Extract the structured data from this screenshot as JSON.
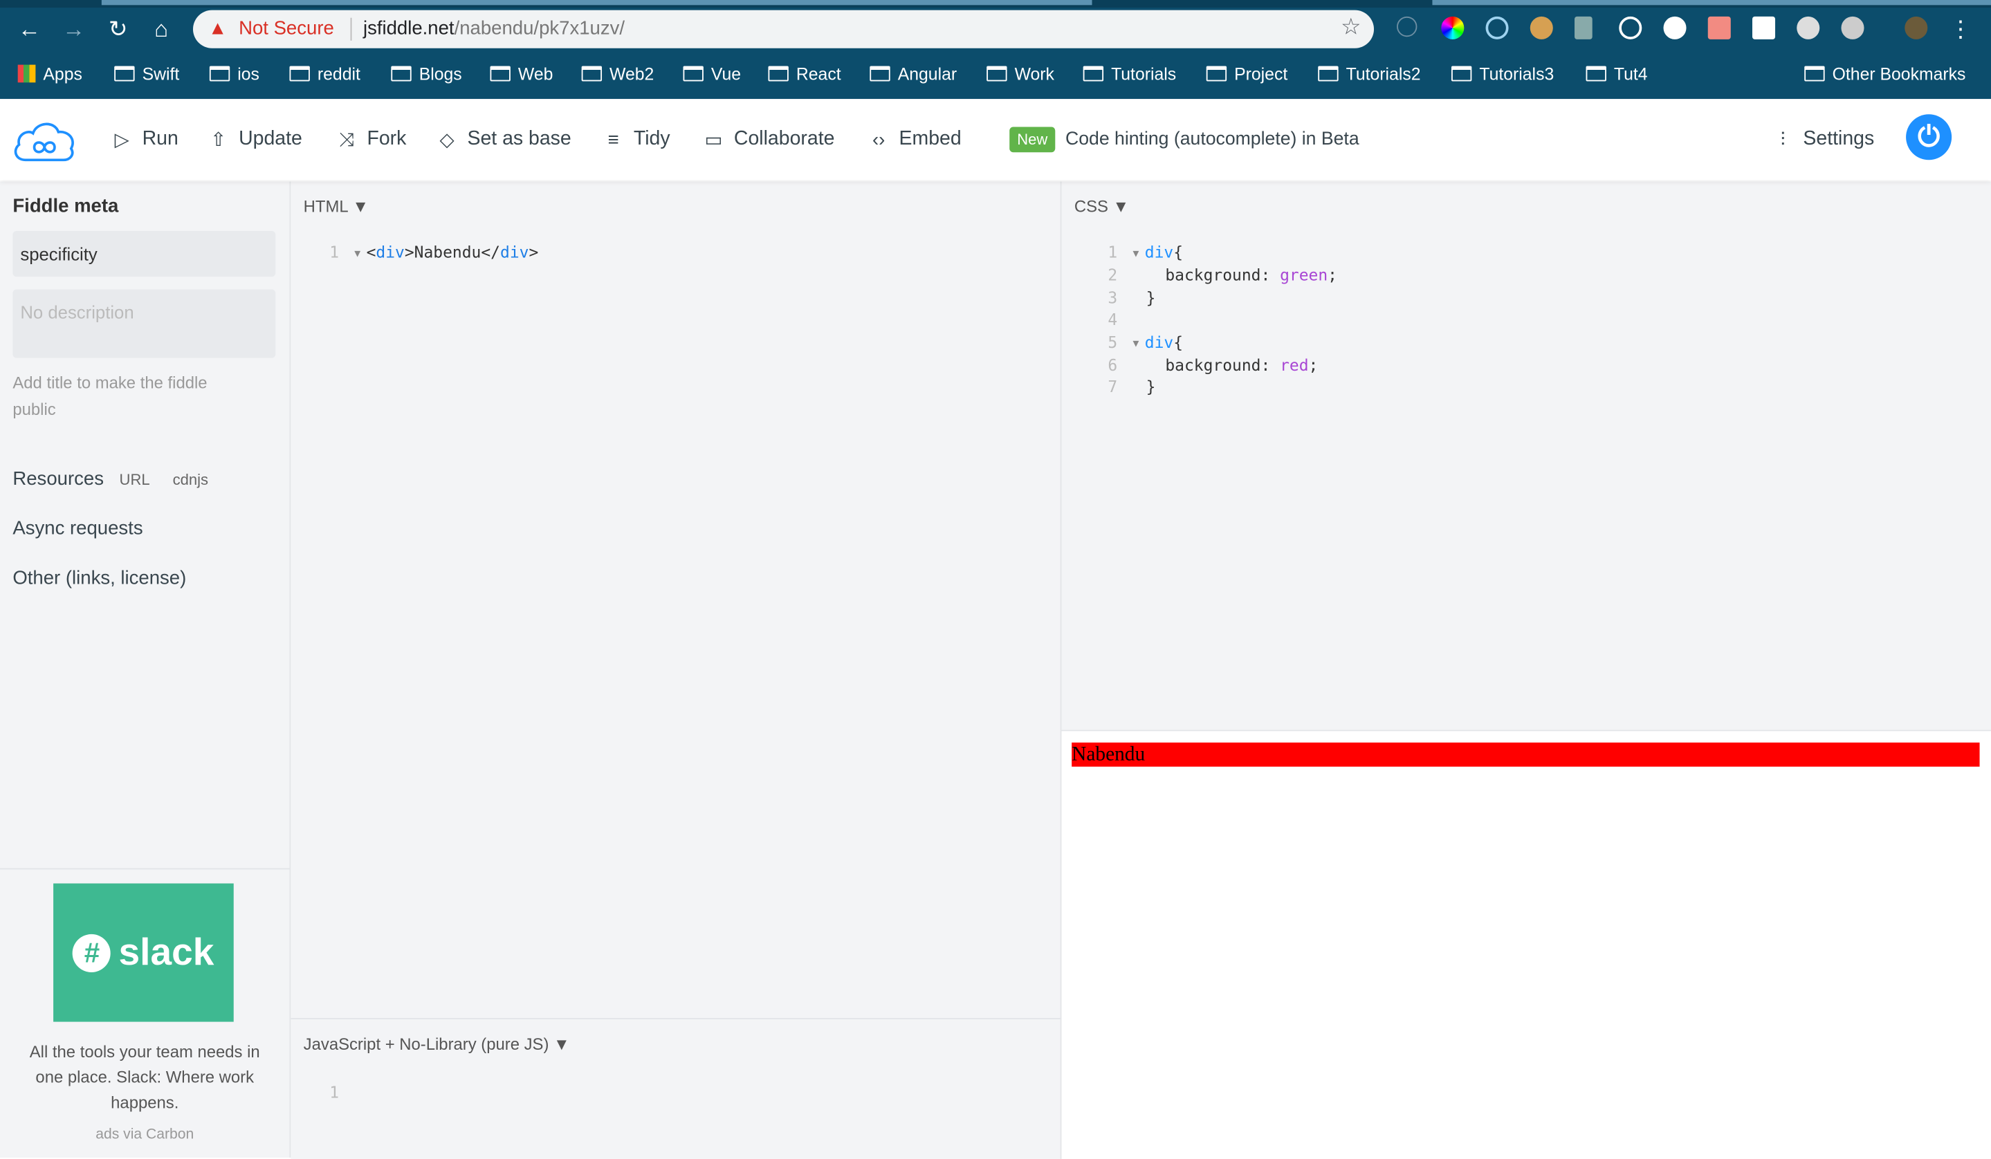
{
  "browser": {
    "security_label": "Not Secure",
    "url_host": "jsfiddle.net",
    "url_path": "/nabendu/pk7x1uzv/",
    "bookmarks": [
      "Apps",
      "Swift",
      "ios",
      "reddit",
      "Blogs",
      "Web",
      "Web2",
      "Vue",
      "React",
      "Angular",
      "Work",
      "Tutorials",
      "Project",
      "Tutorials2",
      "Tutorials3",
      "Tut4"
    ],
    "other_bookmarks": "Other Bookmarks"
  },
  "toolbar": {
    "run": "Run",
    "update": "Update",
    "fork": "Fork",
    "set_as_base": "Set as base",
    "tidy": "Tidy",
    "collaborate": "Collaborate",
    "embed": "Embed",
    "new_badge": "New",
    "hint": "Code hinting (autocomplete) in Beta",
    "settings": "Settings",
    "colors": {
      "brand": "#1e90ff",
      "badge": "#61b44a"
    }
  },
  "sidebar": {
    "heading": "Fiddle meta",
    "title_value": "specificity",
    "description_placeholder": "No description",
    "hint": "Add title to make the fiddle public",
    "resources": "Resources",
    "url": "URL",
    "cdnjs": "cdnjs",
    "async": "Async requests",
    "other": "Other (links, license)",
    "ad": {
      "brand": "slack",
      "text": "All the tools your team needs in one place. Slack: Where work happens.",
      "via": "ads via Carbon"
    }
  },
  "editors": {
    "html": {
      "label": "HTML ▼",
      "line": "1",
      "code_open": "<",
      "tag": "div",
      "code_mid": ">Nabendu</",
      "tag2": "div",
      "code_close": ">"
    },
    "css": {
      "label": "CSS ▼",
      "lines": [
        "1",
        "2",
        "3",
        "4",
        "5",
        "6",
        "7"
      ],
      "sel": "div",
      "prop": "background: ",
      "v1": "green",
      "v2": "red"
    },
    "js": {
      "label": "JavaScript + No-Library (pure JS) ▼",
      "line": "1"
    }
  },
  "result": {
    "text": "Nabendu",
    "background": "#ff0000"
  }
}
